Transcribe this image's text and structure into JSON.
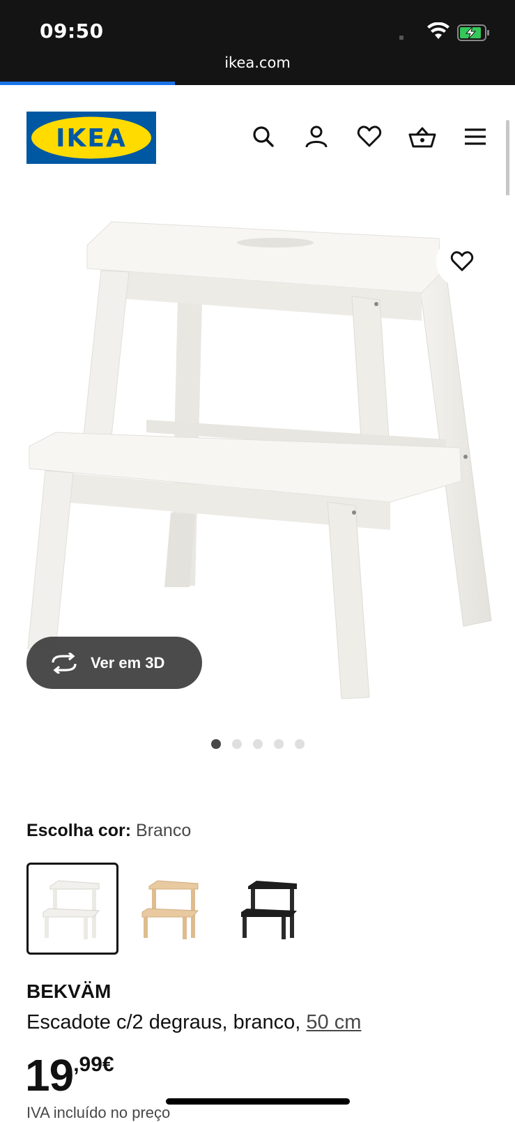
{
  "status_bar": {
    "time": "09:50",
    "url": "ikea.com",
    "load_progress_percent": 34
  },
  "header": {
    "logo_text": "IKEA",
    "icons": [
      "search-icon",
      "account-icon",
      "heart-icon",
      "basket-icon",
      "menu-icon"
    ]
  },
  "gallery": {
    "view3d_label": "Ver em 3D",
    "image_count": 5,
    "active_index": 0
  },
  "color_picker": {
    "label": "Escolha cor:",
    "selected_value": "Branco",
    "options": [
      "white",
      "birch",
      "black"
    ]
  },
  "product": {
    "name": "BEKVÄM",
    "description": "Escadote c/2 degraus, branco,",
    "size_link": "50 cm",
    "price_integer": "19",
    "price_decimal": ",99€",
    "vat_note": "IVA incluído no preço"
  },
  "colors": {
    "ikea_blue": "#0058A3",
    "ikea_yellow": "#FFDB00",
    "progress_blue": "#1a73e8"
  }
}
